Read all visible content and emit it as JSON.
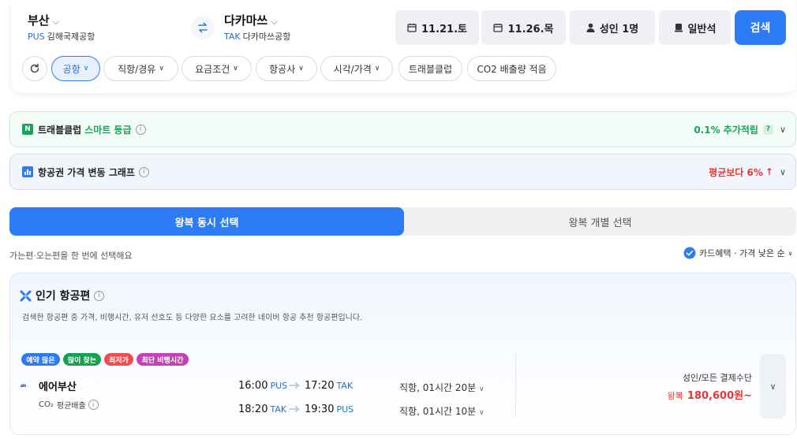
{
  "search": {
    "origin_city": "부산",
    "origin_code": "PUS",
    "origin_airport": "김해국제공항",
    "dest_city": "다카마쓰",
    "dest_code": "TAK",
    "dest_airport": "다카마쓰공항",
    "depart_date": "11.21.토",
    "return_date": "11.26.목",
    "passengers": "성인 1명",
    "cabin": "일반석",
    "search_label": "검색"
  },
  "filters": [
    "공항",
    "직항/경유",
    "요금조건",
    "항공사",
    "시각/가격",
    "트래블클럽",
    "CO2 배출량 적음"
  ],
  "travelclub_bar": {
    "title": "트래블클럽",
    "highlight": "스마트 등급",
    "reward": "0.1% 추가적립",
    "help": "?"
  },
  "price_graph_bar": {
    "title": "항공권 가격 변동 그래프",
    "trend": "평균보다 6%"
  },
  "tabs": {
    "roundtrip_together": "왕복 동시 선택",
    "roundtrip_separate": "왕복 개별 선택"
  },
  "list_header": {
    "hint": "가는편·오는편을 한 번에 선택해요",
    "sort_label": "카드혜택 · 가격 낮은 순"
  },
  "popular": {
    "title": "인기 항공편",
    "description": "검색한 항공편 중 가격, 비행시간, 유저 선호도 등 다양한 요소를 고려한 네이버 항공 추천 항공편입니다.",
    "badges": [
      "예약 많은",
      "많이 찾는",
      "최저가",
      "최단 비행시간"
    ],
    "airline": "에어부산",
    "airline_logo_text": "AIR BUSAN",
    "co2": "평균배출",
    "co2_prefix": "CO₂",
    "outbound": {
      "dep_time": "16:00",
      "dep_code": "PUS",
      "arr_time": "17:20",
      "arr_code": "TAK",
      "info": "직항, 01시간 20분"
    },
    "inbound": {
      "dep_time": "18:20",
      "dep_code": "TAK",
      "arr_time": "19:30",
      "arr_code": "PUS",
      "info": "직항, 01시간 10분"
    },
    "price_note": "성인/모든 결제수단",
    "price_prefix": "왕복",
    "price": "180,600원~"
  },
  "colors": {
    "accent": "#2d7cf6",
    "green": "#1aa35a",
    "red": "#e53935",
    "badge_blue": "#2d7cf6",
    "badge_green": "#13a152",
    "badge_red": "#f04e4e",
    "badge_pink": "#c93fb8"
  }
}
